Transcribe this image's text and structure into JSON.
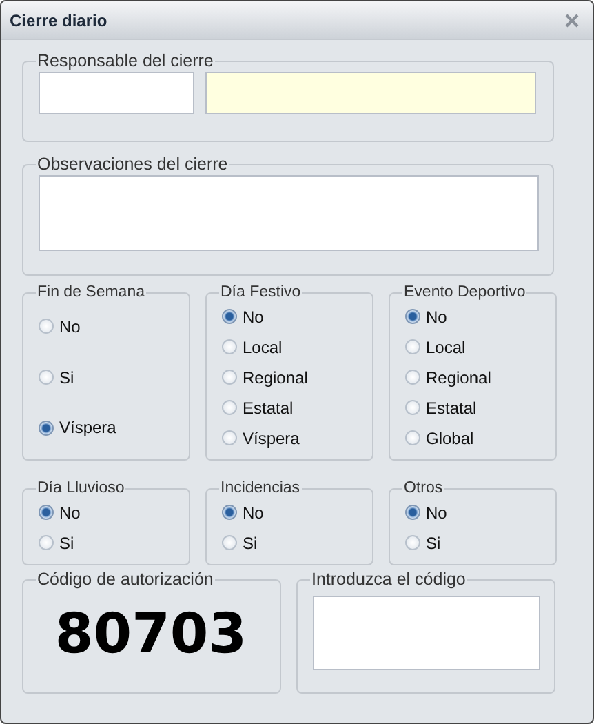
{
  "window": {
    "title": "Cierre diario"
  },
  "responsable": {
    "label": "Responsable del cierre"
  },
  "observaciones": {
    "label": "Observaciones del cierre"
  },
  "radio_groups": [
    {
      "label": "Fin de Semana",
      "options": [
        {
          "label": "No",
          "selected": false
        },
        {
          "label": "Si",
          "selected": false
        },
        {
          "label": "Víspera",
          "selected": true
        }
      ]
    },
    {
      "label": "Día Festivo",
      "options": [
        {
          "label": "No",
          "selected": true
        },
        {
          "label": "Local",
          "selected": false
        },
        {
          "label": "Regional",
          "selected": false
        },
        {
          "label": "Estatal",
          "selected": false
        },
        {
          "label": "Víspera",
          "selected": false
        }
      ]
    },
    {
      "label": "Evento Deportivo",
      "options": [
        {
          "label": "No",
          "selected": true
        },
        {
          "label": "Local",
          "selected": false
        },
        {
          "label": "Regional",
          "selected": false
        },
        {
          "label": "Estatal",
          "selected": false
        },
        {
          "label": "Global",
          "selected": false
        }
      ]
    },
    {
      "label": "Día Lluvioso",
      "options": [
        {
          "label": "No",
          "selected": true
        },
        {
          "label": "Si",
          "selected": false
        }
      ]
    },
    {
      "label": "Incidencias",
      "options": [
        {
          "label": "No",
          "selected": true
        },
        {
          "label": "Si",
          "selected": false
        }
      ]
    },
    {
      "label": "Otros",
      "options": [
        {
          "label": "No",
          "selected": true
        },
        {
          "label": "Si",
          "selected": false
        }
      ]
    }
  ],
  "authorization": {
    "label": "Código de autorización",
    "code": "80703"
  },
  "code_entry": {
    "label": "Introduzca el código"
  }
}
